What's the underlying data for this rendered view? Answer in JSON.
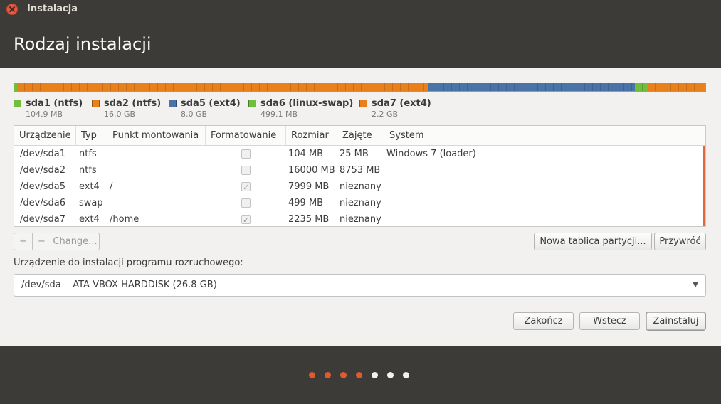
{
  "window": {
    "title": "Instalacja"
  },
  "page": {
    "title": "Rodzaj instalacji"
  },
  "colors": {
    "green": "#6fbe3c",
    "orange": "#e8811c",
    "blue": "#4a73a8",
    "dot_active": "#e05a2b",
    "dot_inactive": "#f2f1f0"
  },
  "partition_bar": [
    {
      "name": "sda1 (ntfs)",
      "size": "104.9 MB",
      "fraction": 0.004,
      "color": "#6fbe3c"
    },
    {
      "name": "sda2 (ntfs)",
      "size": "16.0 GB",
      "fraction": 0.5955,
      "color": "#e8811c"
    },
    {
      "name": "sda5 (ext4)",
      "size": "8.0 GB",
      "fraction": 0.2985,
      "color": "#4a73a8"
    },
    {
      "name": "sda6 (linux-swap)",
      "size": "499.1 MB",
      "fraction": 0.0186,
      "color": "#6fbe3c"
    },
    {
      "name": "sda7 (ext4)",
      "size": "2.2 GB",
      "fraction": 0.0834,
      "color": "#e8811c"
    }
  ],
  "legend": [
    {
      "name": "sda1 (ntfs)",
      "size": "104.9 MB",
      "color": "#6fbe3c"
    },
    {
      "name": "sda2 (ntfs)",
      "size": "16.0 GB",
      "color": "#e8811c"
    },
    {
      "name": "sda5 (ext4)",
      "size": "8.0 GB",
      "color": "#4a73a8"
    },
    {
      "name": "sda6 (linux-swap)",
      "size": "499.1 MB",
      "color": "#6fbe3c"
    },
    {
      "name": "sda7 (ext4)",
      "size": "2.2 GB",
      "color": "#e8811c"
    }
  ],
  "table": {
    "columns": [
      "Urządzenie",
      "Typ",
      "Punkt montowania",
      "Formatowanie",
      "Rozmiar",
      "Zajęte",
      "System"
    ],
    "rows": [
      {
        "device": "/dev/sda1",
        "type": "ntfs",
        "mount": "",
        "format": false,
        "size": "104 MB",
        "used": "25 MB",
        "system": "Windows 7 (loader)"
      },
      {
        "device": "/dev/sda2",
        "type": "ntfs",
        "mount": "",
        "format": false,
        "size": "16000 MB",
        "used": "8753 MB",
        "system": ""
      },
      {
        "device": "/dev/sda5",
        "type": "ext4",
        "mount": "/",
        "format": true,
        "size": "7999 MB",
        "used": "nieznany",
        "system": ""
      },
      {
        "device": "/dev/sda6",
        "type": "swap",
        "mount": "",
        "format": false,
        "size": "499 MB",
        "used": "nieznany",
        "system": ""
      },
      {
        "device": "/dev/sda7",
        "type": "ext4",
        "mount": "/home",
        "format": true,
        "size": "2235 MB",
        "used": "nieznany",
        "system": ""
      }
    ]
  },
  "toolbar": {
    "add": "+",
    "remove": "−",
    "change": "Change...",
    "new_table": "Nowa tablica partycji...",
    "revert": "Przywróć"
  },
  "boot": {
    "label": "Urządzenie do instalacji programu rozruchowego:",
    "selected": "/dev/sda    ATA VBOX HARDDISK (26.8 GB)",
    "arrow": "▼"
  },
  "buttons": {
    "quit": "Zakończ",
    "back": "Wstecz",
    "install": "Zainstaluj"
  },
  "progress": {
    "total_steps": 7,
    "completed_steps": 4
  }
}
